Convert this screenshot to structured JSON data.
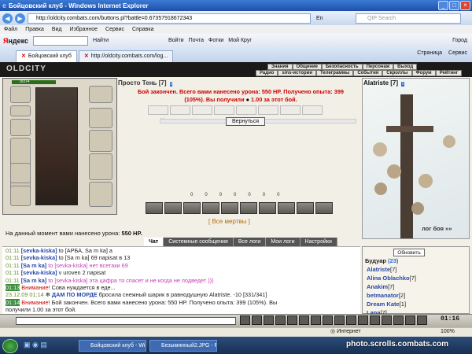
{
  "window": {
    "title": "Бойцовский клуб - Windows Internet Explorer"
  },
  "addressbar": {
    "url": "http://oldcity.combats.com/buttons.pl?battle=0.67357918672343",
    "lang": "En",
    "search_placeholder": "QIP Search"
  },
  "menu": [
    "Файл",
    "Правка",
    "Вид",
    "Избранное",
    "Сервис",
    "Справка"
  ],
  "yandex": {
    "find_label": "Найти",
    "links": [
      "Войти",
      "Почта",
      "Фотки",
      "Мой Круг"
    ],
    "city": "Город"
  },
  "tabs": [
    {
      "label": "Бойцовский клуб"
    },
    {
      "label": "http://oldcity.combats.com/log..."
    }
  ],
  "page_tools": {
    "page": "Страница",
    "tools": "Сервис"
  },
  "game": {
    "logo": "OLDCITY",
    "nav_top": [
      "Знания",
      "Общение",
      "Безопасность",
      "Персонаж",
      "Выход"
    ],
    "nav_bottom": [
      "Радио",
      "sms-истории",
      "Телеграммы",
      "События",
      "Скроллы",
      "Форум",
      "Рейтинг"
    ],
    "hp": "0/374",
    "enemy": {
      "name": "Просто Тень",
      "level": "[7]",
      "badge": "i"
    },
    "result_line1": "Бой закончен. Всего вами нанесено урона: 550 HP. Получено опыта: 399",
    "result_line2": "(105%). Вы получили",
    "result_money": "1.00 за этот бой.",
    "back_button": "Вернуться",
    "stats": [
      "0",
      "0",
      "0",
      "0",
      "0",
      "0",
      "0"
    ],
    "all_dead": "[ Все мертвы ]",
    "opponent": {
      "name": "Alatriste",
      "level": "[7]",
      "badge": "i"
    },
    "battle_log_link": "лог боя »»",
    "damage_text": "На данный момент вами нанесено урона:",
    "damage_value": "550 HP."
  },
  "chat_tabs": [
    "Чат",
    "Системные сообщения",
    "Все логи",
    "Мои логи",
    "Настройки"
  ],
  "chat": [
    {
      "time": "01:11",
      "nick": "[sevka-kiska]",
      "text": "to [АРБА, Sa m ka] а"
    },
    {
      "time": "01:11",
      "nick": "[sevka-kiska]",
      "text": "to [Sa m ka] 69 napisat в 13"
    },
    {
      "time": "01:11",
      "nick": "[Sa m ka]",
      "text": "to [sevka-kiska] нет всетаки 69"
    },
    {
      "time": "01:11",
      "nick": "[sevka-kiska]",
      "text": "v uroven 2 napisat"
    },
    {
      "time": "01:11",
      "nick": "[Sa m ka]",
      "text": "to [sevka-kiska] эта цафра тя спасет и не когда не подведет )))"
    },
    {
      "time": "01:13",
      "nick": "Внимание!",
      "text": "Сова нуждается в еде..."
    },
    {
      "time": "23.12.09 01:14",
      "nick": "ДАМ ПО МОРДЕ",
      "text": "бросила снежный шарик в равнодушную Alatriste. -10 [331/341]"
    },
    {
      "time": "01:14",
      "nick": "Внимание!",
      "text": "Бой закончен. Всего вами нанесено урона: 550 HP. Получено опыта: 399 (105%). Вы"
    },
    {
      "time": "",
      "nick": "",
      "text": "получили 1.00 за этот бой."
    }
  ],
  "right_panel": {
    "refresh_button": "Обновить",
    "location": "Будуар",
    "count": "(23)",
    "players": [
      {
        "name": "Alatriste",
        "level": "[7]"
      },
      {
        "name": "Alina Oblachko",
        "level": "[7]"
      },
      {
        "name": "Anakim",
        "level": "[7]"
      },
      {
        "name": "betmanator",
        "level": "[2]"
      },
      {
        "name": "Dream Kate",
        "level": "[1]"
      },
      {
        "name": "Lana",
        "level": "[7]"
      }
    ]
  },
  "clock": "01:16",
  "statusbar": {
    "zone": "Интернет",
    "zoom": "100%"
  },
  "taskbar": {
    "tasks": [
      "Бойцовский клуб - Wi...",
      "Безымянный2.JPG - P..."
    ],
    "watermark": "photo.scrolls.combats.com"
  }
}
